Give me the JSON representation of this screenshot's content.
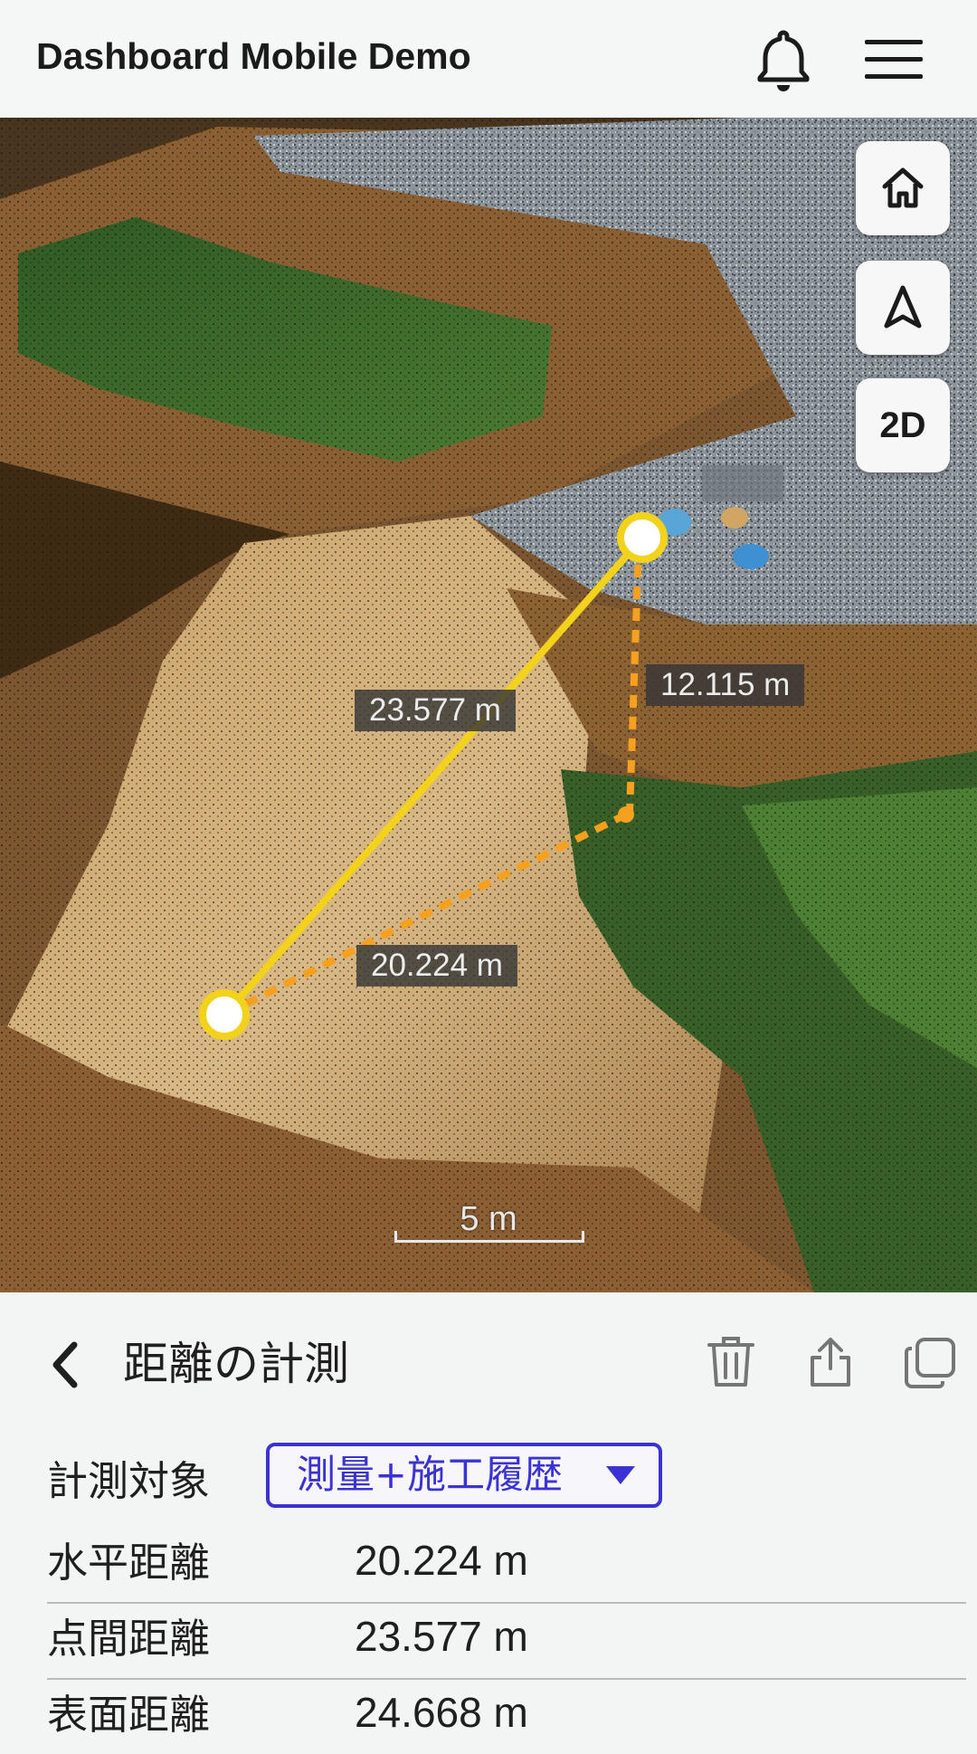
{
  "header": {
    "title": "Dashboard Mobile Demo",
    "bell_icon": "bell-icon",
    "menu_icon": "hamburger-menu-icon"
  },
  "map": {
    "controls": {
      "home_icon": "home-icon",
      "north_icon": "navigation-arrow-icon",
      "view_toggle_label": "2D"
    },
    "labels": {
      "direct_distance": "23.577 m",
      "vertical_distance": "12.115 m",
      "horizontal_distance": "20.224 m"
    },
    "scale_bar": "5 m",
    "colors": {
      "measure_line": "#f2d21a",
      "measure_dashed": "#f5a01e",
      "point_fill": "#ffffff"
    }
  },
  "panel": {
    "title": "距離の計測",
    "actions": [
      "trash-icon",
      "share-icon",
      "copy-icon"
    ],
    "target": {
      "label": "計測対象",
      "selected": "測量+施工履歴",
      "accent": "#3b32d6"
    },
    "results": [
      {
        "label": "水平距離",
        "value": "20.224 m"
      },
      {
        "label": "点間距離",
        "value": "23.577 m"
      },
      {
        "label": "表面距離",
        "value": "24.668 m"
      }
    ]
  }
}
